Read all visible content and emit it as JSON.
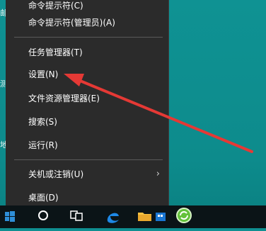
{
  "context_menu": {
    "items": [
      {
        "label": "命令提示符(C)"
      },
      {
        "label": "命令提示符(管理员)(A)"
      },
      {
        "label": "任务管理器(T)"
      },
      {
        "label": "设置(N)"
      },
      {
        "label": "文件资源管理器(E)"
      },
      {
        "label": "搜索(S)"
      },
      {
        "label": "运行(R)"
      },
      {
        "label": "关机或注销(U)",
        "submenu_indicator": "›"
      },
      {
        "label": "桌面(D)"
      }
    ]
  },
  "desktop": {
    "edge_glyphs": [
      "邮",
      "测",
      "地"
    ]
  },
  "taskbar": {
    "icons": [
      "windows-start-icon",
      "cortana-search-icon",
      "task-view-icon",
      "edge-browser-icon",
      "file-explorer-icon",
      "store-icon",
      "green-refresh-app-icon"
    ]
  },
  "colors": {
    "menu_bg": "#2b2b2b",
    "menu_text": "#ffffff",
    "desktop": "#0f8f91",
    "taskbar": "#0b1417",
    "annotation_arrow": "#e53935"
  }
}
